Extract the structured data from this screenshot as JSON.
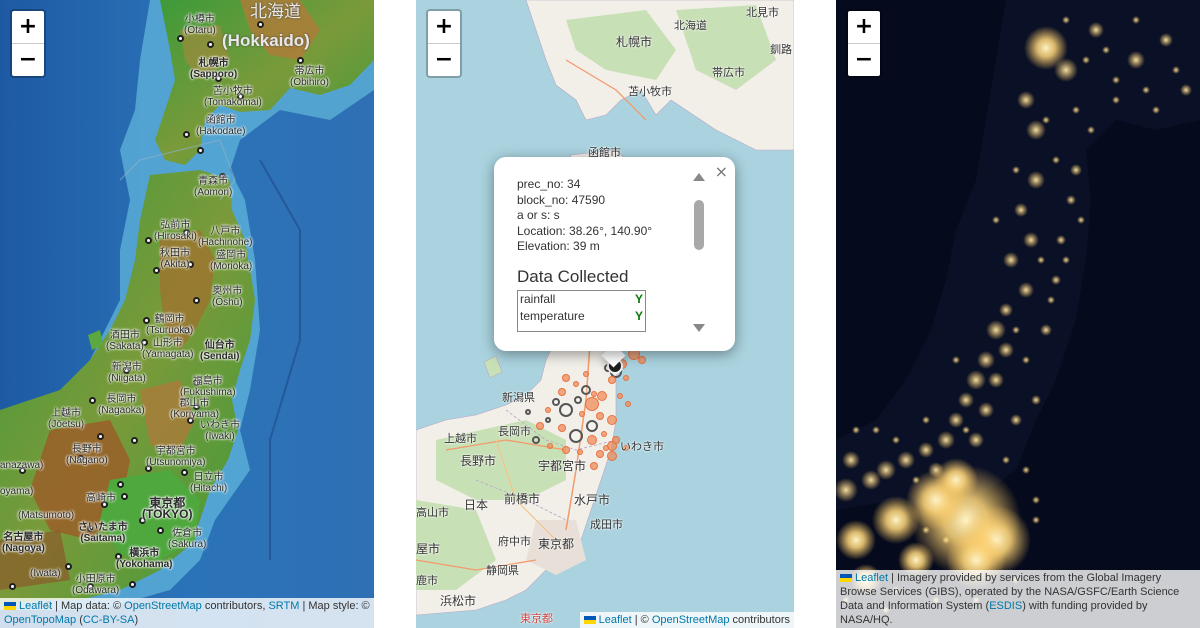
{
  "topo_panel": {
    "zoom_in": "+",
    "zoom_out": "−",
    "labels": {
      "hokkaido_jp": "北海道",
      "hokkaido_en": "(Hokkaido)",
      "otaru": "小樽市\n(Otaru)",
      "sapporo": "札幌市\n(Sapporo)",
      "tomakomai": "苫小牧市\n(Tomakomai)",
      "obihiro": "帯広市\n(Obihiro)",
      "hakodate": "函館市\n(Hakodate)",
      "aomori": "青森市\n(Aomori)",
      "hirosaki": "弘前市\n(Hirosaki)",
      "hachinohe": "八戸市\n(Hachinohe)",
      "akita": "秋田市\n(Akita)",
      "morioka": "盛岡市\n(Morioka)",
      "oshu": "奥州市\n(Ōshū)",
      "tsuruoka": "鶴岡市\n(Tsuruoka)",
      "sakata": "酒田市\n(Sakata)",
      "yamagata": "山形市\n(Yamagata)",
      "sendai": "仙台市\n(Sendai)",
      "niigata": "新潟市\n(Niigata)",
      "fukushima": "福島市\n(Fukushima)",
      "nagaoka": "長岡市\n(Nagaoka)",
      "koriyama": "郡山市\n(Koriyama)",
      "joetsu": "上越市\n(Jōetsu)",
      "iwaki": "いわき市\n(Iwaki)",
      "nagano": "長野市\n(Nagano)",
      "kanazawa": "anazawa)",
      "toyama": "oyama)",
      "utsunomiya": "宇都宮市\n(Utsunomiya)",
      "hitachi": "日立市\n(Hitachi)",
      "matsumoto": "(Matsumoto)",
      "takasaki": "高崎市",
      "tokyo": "東京都\n(TOKYO)",
      "saitama": "さいたま市\n(Saitama)",
      "sakura": "佐倉市\n(Sakura)",
      "nagoya": "名古屋市\n(Nagoya)",
      "yokohama": "横浜市\n(Yokohama)",
      "iwata": "(Iwata)",
      "odawara": "小田原市\n(Odawara)"
    },
    "attribution": {
      "leaflet": "Leaflet",
      "sep1": " | Map data: © ",
      "osm": "OpenStreetMap",
      "contrib": " contributors, ",
      "srtm": "SRTM",
      "style": " | Map style: © ",
      "opentopo": "OpenTopoMap",
      "paren_open": " (",
      "license": "CC-BY-SA",
      "paren_close": ")"
    },
    "colors": {
      "sea_deep": "#1f5fa6",
      "sea_shallow": "#4fa3cf",
      "lowland": "#3f9a38",
      "highland": "#a06a2e"
    }
  },
  "osm_panel": {
    "zoom_in": "+",
    "zoom_out": "−",
    "labels": {
      "kitami": "北見市",
      "sapporo": "札幌市",
      "hokkaido": "北海道",
      "kushiro": "釧路",
      "obihiro": "帯広市",
      "tomakomai": "苫小牧市",
      "hakodate": "函館市",
      "niigata": "新潟県",
      "joetsu": "上越市",
      "nagaoka": "長岡市",
      "nagano": "長野市",
      "utsunomiya": "宇都宮市",
      "iwaki": "いわき市",
      "maebashi": "前橋市",
      "mito": "水戸市",
      "nihon": "日本",
      "takayama": "高山市",
      "fuchu": "府中市",
      "narita": "成田市",
      "tokyo": "東京都",
      "ya": "屋市",
      "shizuoka": "静岡県",
      "ka": "鹿市",
      "hamamatsu": "浜松市",
      "tokyo_ward": "東京都"
    },
    "popup": {
      "prec_no": "prec_no: 34",
      "block_no": "block_no: 47590",
      "a_or_s": "a or s: s",
      "location": "Location: 38.26°, 140.90°",
      "elevation": "Elevation: 39 m",
      "title": "Data Collected",
      "rows": [
        {
          "label": "rainfall",
          "value": "Y"
        },
        {
          "label": "temperature",
          "value": "Y"
        }
      ],
      "close": "×"
    },
    "attribution": {
      "leaflet": "Leaflet",
      "sep": " | © ",
      "osm": "OpenStreetMap",
      "contrib": " contributors"
    },
    "colors": {
      "sea": "#aad3df",
      "land": "#f2efe9",
      "forest": "#c8e0b6",
      "station_orange": "#f08c5a",
      "station_gray": "#555555"
    }
  },
  "night_panel": {
    "zoom_in": "+",
    "zoom_out": "−",
    "attribution": {
      "leaflet": "Leaflet",
      "text1": " | Imagery provided by services from the Global Imagery Browse Services (GIBS), operated by the NASA/GSFC/Earth Science Data and Information System (",
      "esdis": "ESDIS",
      "text2": ") with funding provided by NASA/HQ."
    },
    "colors": {
      "background": "#050a1c",
      "lights": "#ffd782"
    }
  }
}
